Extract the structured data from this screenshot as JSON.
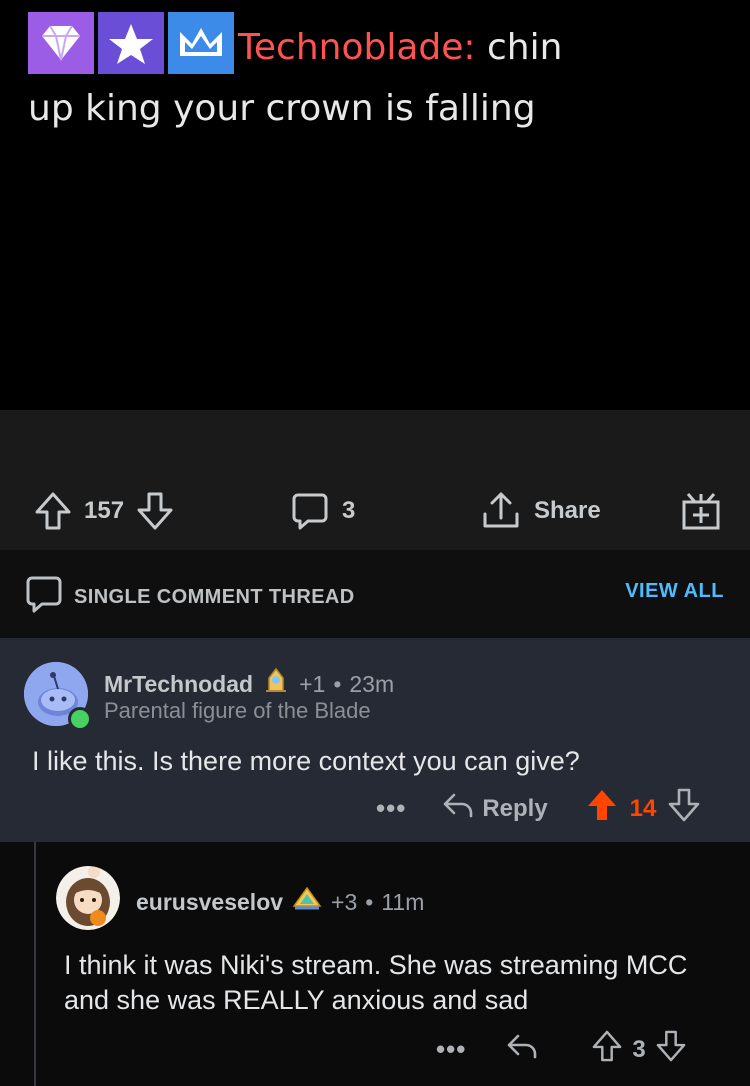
{
  "post": {
    "chat_name": "Technoblade:",
    "chat_message_line1": " chin",
    "chat_message_line2": "up king your crown is falling",
    "badges": [
      "gem-icon",
      "star-icon",
      "crown-icon"
    ],
    "colors": {
      "chat_name": "#ff5252",
      "gem_badge": "#9b5de5",
      "star_badge": "#6a4fd6",
      "crown_badge": "#3d8be8"
    }
  },
  "actions": {
    "upvotes": "157",
    "comments": "3",
    "share_label": "Share"
  },
  "thread": {
    "label": "SINGLE COMMENT THREAD",
    "view_all": "VIEW ALL"
  },
  "comments": [
    {
      "username": "MrTechnodad",
      "karma": "+1",
      "separator": "•",
      "time": "23m",
      "flair": "Parental figure of the Blade",
      "body": "I like this. Is there more context you can give?",
      "more": "•••",
      "reply_label": "Reply",
      "score": "14",
      "score_color": "#ff4500"
    },
    {
      "username": "eurusveselov",
      "karma": "+3",
      "separator": "•",
      "time": "11m",
      "body": "I think it was Niki's stream. She was streaming MCC and she was REALLY anxious and sad",
      "more": "•••",
      "score": "3"
    }
  ]
}
